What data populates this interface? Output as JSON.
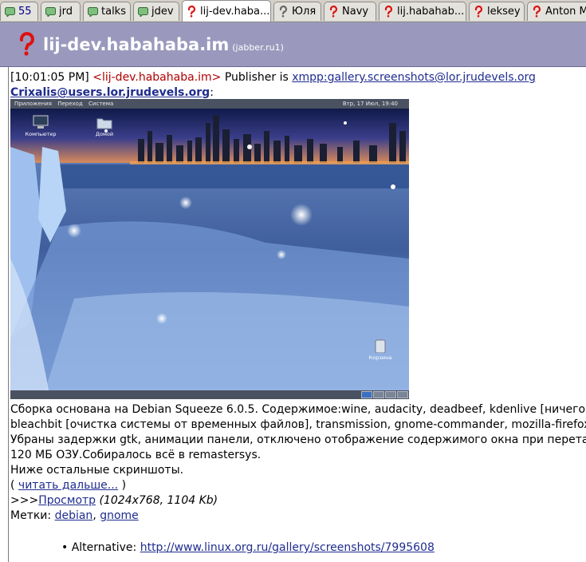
{
  "tabs": [
    {
      "label": "55",
      "icon": "chat-icon",
      "blue": true
    },
    {
      "label": "jrd",
      "icon": "chat-icon"
    },
    {
      "label": "talks",
      "icon": "chat-icon"
    },
    {
      "label": "jdev",
      "icon": "chat-icon"
    },
    {
      "label": "lij-dev.haba...",
      "icon": "question-icon",
      "active": true
    },
    {
      "label": "Юля",
      "icon": "offline-question-icon"
    },
    {
      "label": "Navy",
      "icon": "question-icon"
    },
    {
      "label": "lij.habahab...",
      "icon": "question-icon"
    },
    {
      "label": "leksey",
      "icon": "question-icon"
    },
    {
      "label": "Anton M",
      "icon": "question-icon"
    }
  ],
  "header": {
    "title": "lij-dev.habahaba.im",
    "subtitle": "(jabber.ru1)",
    "icon": "question-icon"
  },
  "message": {
    "timestamp": "[10:01:05 PM]",
    "nick": "<lij-dev.habahaba.im>",
    "publisher_text": "Publisher is",
    "publisher_link": "xmpp:gallery.screenshots@lor.jrudevels.org",
    "author_jid": "Crixalis@users.lor.jrudevels.org",
    "colon": ":"
  },
  "screenshot": {
    "menu_apps": "Приложения",
    "menu_places": "Переход",
    "menu_system": "Система",
    "clock": "Втр, 17 Июл, 19:40",
    "icon_computer": "Компьютер",
    "icon_home": "Домой",
    "icon_trash": "Корзина"
  },
  "body_lines": [
    "Сборка основана на Debian Squeeze 6.0.5. Содержимое:wine, audacity, deadbeef, kdenlive [ничего",
    "bleachbit [очистка системы от временных файлов], transmission, gnome-commander, mozilla-firefox",
    "Убраны задержки gtk, анимации панели, отключено отображение содержимого окна при перетас",
    "120 МБ ОЗУ.Собиралось всё в remastersys.",
    "Ниже остальные скриншоты."
  ],
  "read_more": {
    "open": "( ",
    "link": "читать дальше...",
    "close": " )"
  },
  "preview": {
    "prefix": ">>>",
    "link": "Просмотр",
    "details": "(1024x768, 1104 Kb)"
  },
  "tags": {
    "label": "Метки:",
    "items": [
      "debian",
      "gnome"
    ],
    "separator": ","
  },
  "alternative": {
    "bullet": "•",
    "label": "Alternative:",
    "link": "http://www.linux.org.ru/gallery/screenshots/7995608"
  }
}
